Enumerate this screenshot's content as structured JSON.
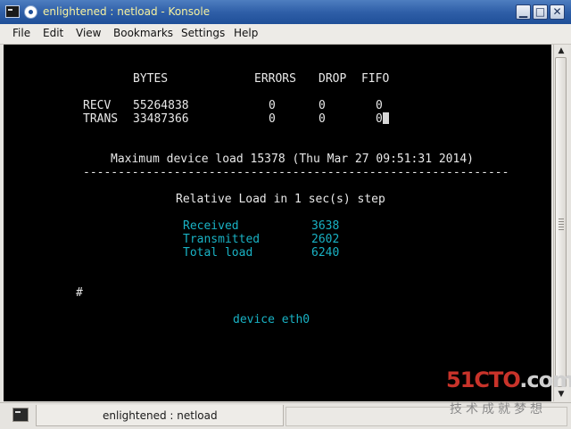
{
  "window": {
    "title": "enlightened : netload - Konsole",
    "buttons": {
      "minimize": "▁",
      "maximize": "□",
      "close": "✕"
    }
  },
  "menubar": {
    "items": [
      "File",
      "Edit",
      "View",
      "Bookmarks",
      "Settings",
      "Help"
    ]
  },
  "terminal": {
    "header": {
      "bytes": "BYTES",
      "errors": "ERRORS",
      "drop": "DROP",
      "fifo": "FIFO"
    },
    "recv": {
      "label": "RECV",
      "bytes": "55264838",
      "errors": "0",
      "drop": "0",
      "fifo": "0"
    },
    "trans": {
      "label": "TRANS",
      "bytes": "33487366",
      "errors": "0",
      "drop": "0",
      "fifo": "0"
    },
    "max_load": "Maximum device load 15378 (Thu Mar 27 09:51:31 2014)",
    "separator": "-------------------------------------------------------------",
    "relative_load": "Relative Load in 1 sec(s) step",
    "stats": [
      {
        "label": "Received",
        "value": "3638"
      },
      {
        "label": "Transmitted",
        "value": "2602"
      },
      {
        "label": "Total load",
        "value": "6240"
      }
    ],
    "prompt": "#",
    "device": "device eth0"
  },
  "tabbar": {
    "tab_label": "enlightened : netload"
  },
  "watermark": {
    "main_red": "51CTO",
    "main_gray": ".com",
    "sub": "技术成就梦想"
  },
  "colors": {
    "terminal_bg": "#000000",
    "terminal_fg": "#e8e8e8",
    "accent_cyan": "#19b2c4",
    "titlebar": "#2f5fa8",
    "title_text": "#f7f2a0"
  }
}
